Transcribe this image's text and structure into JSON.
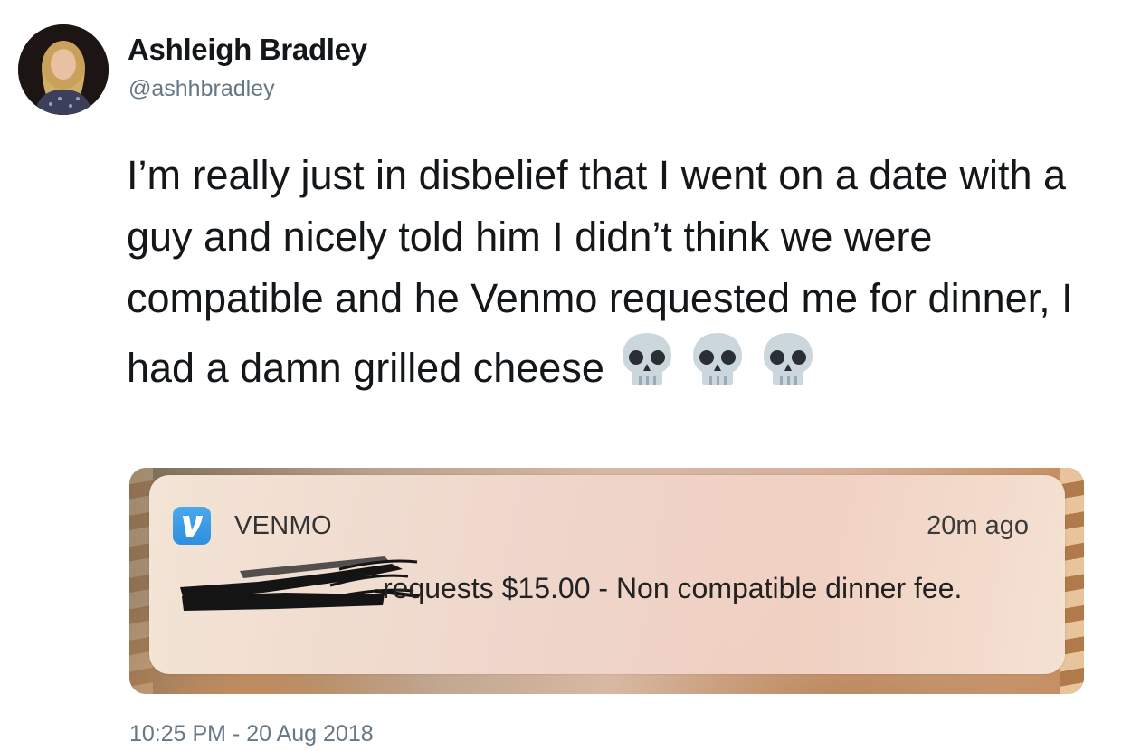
{
  "author": {
    "name": "Ashleigh Bradley",
    "handle": "@ashhbradley",
    "avatar_icon": "profile-photo"
  },
  "tweet": {
    "text": "I’m really just in disbelief that I went on a date with a guy and nicely told him I didn’t think we were compatible and he Venmo requested me for dinner, I had a damn grilled cheese",
    "emoji": [
      "skull",
      "skull",
      "skull"
    ],
    "timestamp": "10:25 PM - 20 Aug 2018"
  },
  "notification": {
    "app_icon": "venmo-v-icon",
    "app_name": "VENMO",
    "time_ago": "20m ago",
    "message": "requests $15.00 - Non compatible dinner fee.",
    "accent_color": "#3d95ce"
  },
  "colors": {
    "text": "#14171a",
    "secondary": "#657786"
  }
}
